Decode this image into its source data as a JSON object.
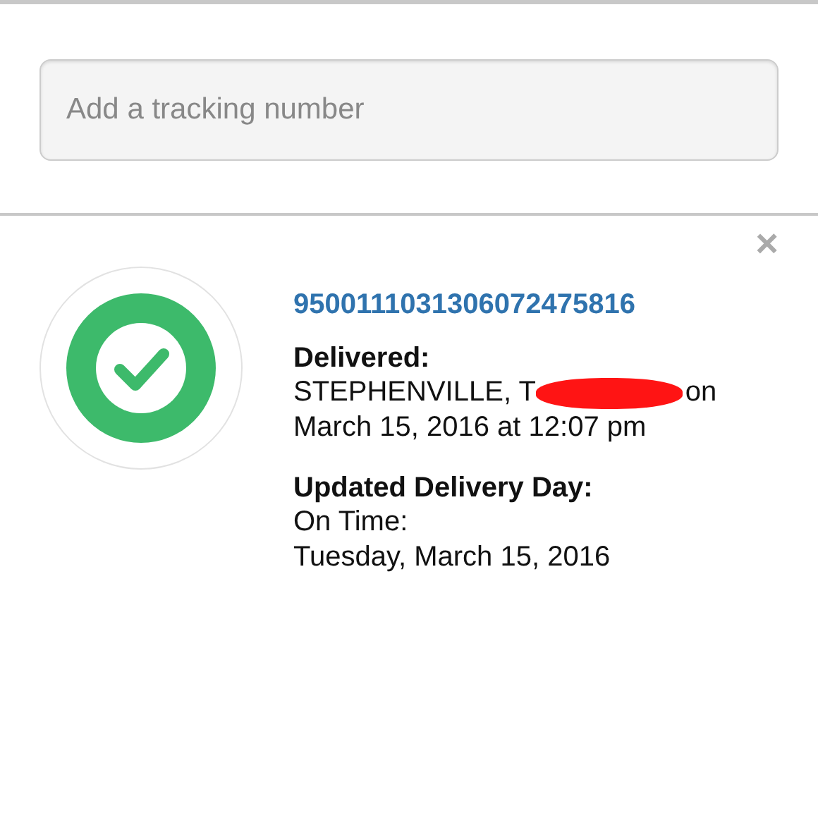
{
  "search": {
    "placeholder": "Add a tracking number"
  },
  "shipment": {
    "delivered": true,
    "tracking_number": "9500111031306072475816",
    "sections": [
      {
        "heading": "Delivered:",
        "lines": [
          {
            "text": "STEPHENVILLE, T",
            "redacted": true,
            "after": "on"
          },
          {
            "text": "March 15, 2016 at 12:07 pm",
            "redacted": false
          }
        ]
      },
      {
        "heading": "Updated Delivery Day:",
        "lines": [
          {
            "text": "On Time:",
            "redacted": false
          },
          {
            "text": "Tuesday, March 15, 2016",
            "redacted": false
          }
        ]
      }
    ],
    "close": "×"
  }
}
